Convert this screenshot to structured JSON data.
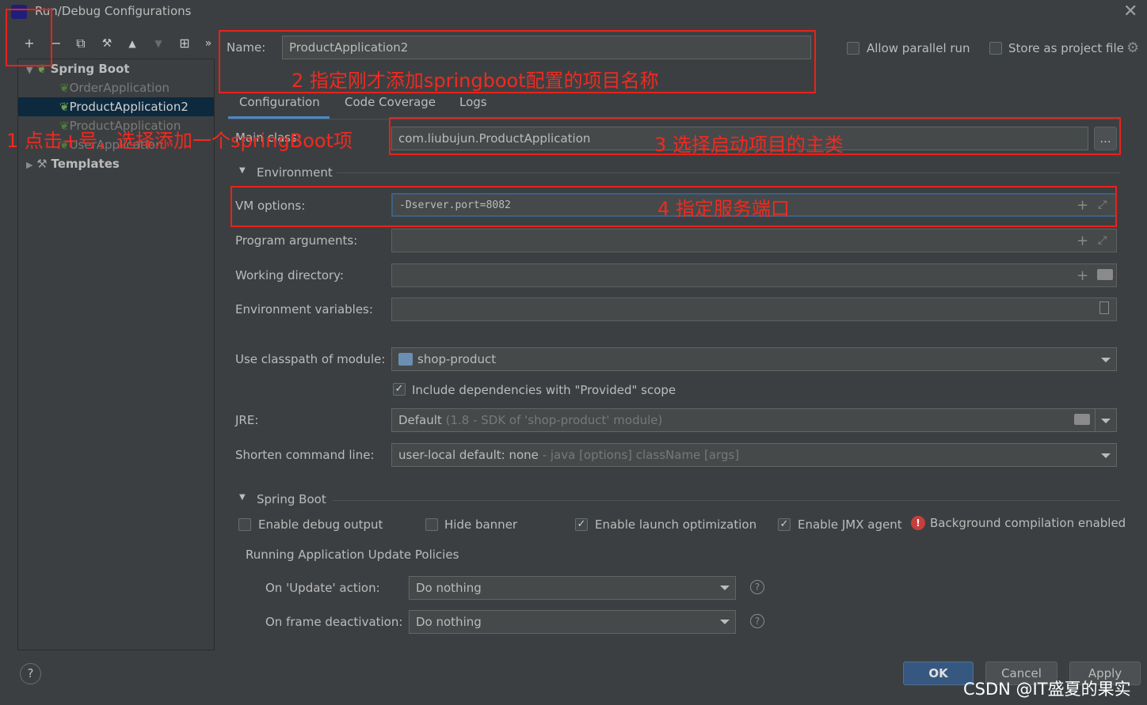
{
  "window": {
    "title": "Run/Debug Configurations"
  },
  "toolbar": {
    "add": "+",
    "remove": "−",
    "copy": "⧉",
    "wrench": "🔧",
    "up": "▲",
    "down": "▼",
    "folder": "⊞",
    "more": "»"
  },
  "tree": {
    "spring_boot": "Spring Boot",
    "items": [
      "OrderApplication",
      "ProductApplication2",
      "ProductApplication",
      "UserApplication"
    ],
    "templates": "Templates"
  },
  "name": {
    "label": "Name:",
    "value": "ProductApplication2"
  },
  "options": {
    "parallel": "Allow parallel run",
    "store": "Store as project file"
  },
  "tabs": [
    "Configuration",
    "Code Coverage",
    "Logs"
  ],
  "main_class": {
    "label": "Main class:",
    "value": "com.liubujun.ProductApplication",
    "browse": "..."
  },
  "environment": {
    "header": "Environment"
  },
  "vm_options": {
    "label": "VM options:",
    "value": "-Dserver.port=8082"
  },
  "program_args": {
    "label": "Program arguments:"
  },
  "working_dir": {
    "label": "Working directory:"
  },
  "env_vars": {
    "label": "Environment variables:"
  },
  "classpath": {
    "label": "Use classpath of module:",
    "value": "shop-product"
  },
  "include_deps": {
    "label": "Include dependencies with \"Provided\" scope"
  },
  "jre": {
    "label": "JRE:",
    "value": "Default",
    "hint": "(1.8 - SDK of 'shop-product' module)"
  },
  "shorten": {
    "label": "Shorten command line:",
    "value": "user-local default: none",
    "hint": "- java [options] className [args]"
  },
  "spring_boot": {
    "header": "Spring Boot",
    "debug_output": "Enable debug output",
    "hide_banner": "Hide banner",
    "launch_opt": "Enable launch optimization",
    "jmx": "Enable JMX agent",
    "bg_compilation": "Background compilation enabled",
    "policies": "Running Application Update Policies",
    "update_label": "On 'Update' action:",
    "update_value": "Do nothing",
    "frame_label": "On frame deactivation:",
    "frame_value": "Do nothing"
  },
  "buttons": {
    "ok": "OK",
    "cancel": "Cancel",
    "apply": "Apply",
    "help": "?"
  },
  "annotations": {
    "a1": "1 点击+号，选择添加一个springBoot项",
    "a2": "2 指定刚才添加springboot配置的项目名称",
    "a3": "3 选择启动项目的主类",
    "a4": "4 指定服务端口"
  },
  "watermark": "CSDN @IT盛夏的果实",
  "colors": {
    "annotation": "#e8221b",
    "accent": "#4a88c7",
    "ok_button": "#365880"
  }
}
